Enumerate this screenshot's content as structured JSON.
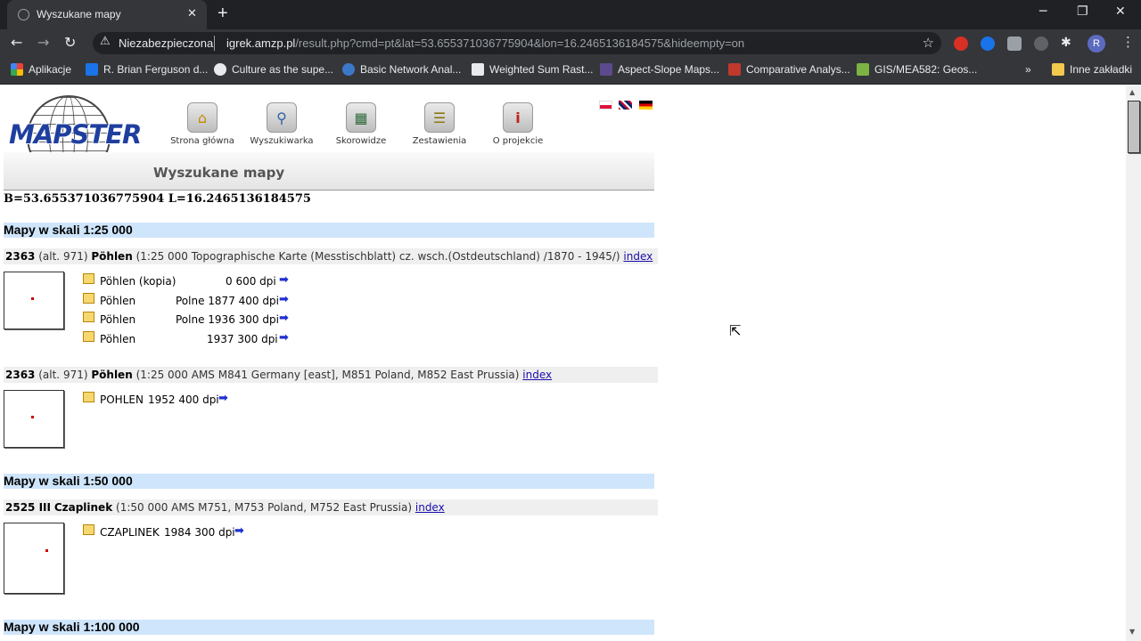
{
  "browser": {
    "tab_title": "Wyszukane mapy",
    "security_label": "Niezabezpieczona",
    "url_host": "igrek.amzp.pl",
    "url_path": "/result.php?cmd=pt&lat=53.655371036775904&lon=16.2465136184575&hideempty=on",
    "bookmarks": [
      {
        "label": "Aplikacje",
        "color": "#4285f4"
      },
      {
        "label": "R. Brian Ferguson d...",
        "color": "#1a73e8"
      },
      {
        "label": "Culture as the supe...",
        "color": "#e8eaed"
      },
      {
        "label": "Basic Network Anal...",
        "color": "#3c78c8"
      },
      {
        "label": "Weighted Sum Rast...",
        "color": "#e8eaed"
      },
      {
        "label": "Aspect-Slope Maps...",
        "color": "#5b4a8c"
      },
      {
        "label": "Comparative Analys...",
        "color": "#c0392b"
      },
      {
        "label": "GIS/MEA582: Geos...",
        "color": "#7cb342"
      }
    ],
    "other_bookmarks": "Inne zakładki",
    "more_bookmarks": "»",
    "profile_initial": "R"
  },
  "site": {
    "logo_text": "MAPSTER",
    "nav": [
      {
        "label": "Strona główna",
        "icon": "home-icon"
      },
      {
        "label": "Wyszukiwarka",
        "icon": "magnifier-icon"
      },
      {
        "label": "Skorowidze",
        "icon": "grid-map-icon"
      },
      {
        "label": "Zestawienia",
        "icon": "list-document-icon"
      },
      {
        "label": "O projekcie",
        "icon": "info-icon"
      }
    ],
    "page_title": "Wyszukane mapy",
    "coords": "B=53.655371036775904 L=16.2465136184575"
  },
  "results": {
    "scale_25k": "Mapy w skali 1:25 000",
    "scale_50k": "Mapy w skali 1:50 000",
    "scale_100k": "Mapy w skali 1:100 000",
    "sheet1": {
      "num": "2363",
      "alt": "(alt. 971)",
      "name": "Pöhlen",
      "desc": "(1:25 000 Topographische Karte (Messtischblatt) cz. wsch.(Ostdeutschland) /1870 - 1945/)",
      "index": "index"
    },
    "sheet1_entries": [
      {
        "name": "Pöhlen (kopia)",
        "info": "0 600 dpi"
      },
      {
        "name": "Pöhlen",
        "info": "Polne 1877 400 dpi"
      },
      {
        "name": "Pöhlen",
        "info": "Polne 1936 300 dpi"
      },
      {
        "name": "Pöhlen",
        "info": "1937 300 dpi"
      }
    ],
    "sheet2": {
      "num": "2363",
      "alt": "(alt. 971)",
      "name": "Pöhlen",
      "desc": "(1:25 000 AMS M841 Germany [east], M851 Poland, M852 East Prussia)",
      "index": "index"
    },
    "sheet2_entries": [
      {
        "name": "POHLEN",
        "info": "1952 400 dpi"
      }
    ],
    "sheet3": {
      "num": "2525 III",
      "name": "Czaplinek",
      "desc": "(1:50 000 AMS M751, M753 Poland, M752 East Prussia)",
      "index": "index"
    },
    "sheet3_entries": [
      {
        "name": "CZAPLINEK",
        "info": "1984 300 dpi"
      }
    ]
  }
}
